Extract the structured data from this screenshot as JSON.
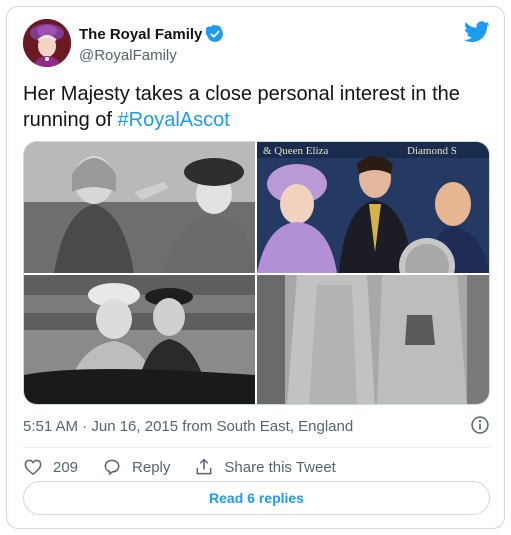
{
  "account": {
    "name": "The Royal Family",
    "handle": "@RoyalFamily"
  },
  "tweet": {
    "text": "Her Majesty takes a close personal interest in the running of ",
    "hashtag": "#RoyalAscot"
  },
  "media": {
    "sign_text": "& Queen Eliza",
    "sign_text_right": "Diamond S"
  },
  "meta": {
    "timestamp": "5:51 AM · Jun 16, 2015 from South East, England"
  },
  "actions": {
    "likes": "209",
    "reply_label": "Reply",
    "share_label": "Share this Tweet"
  },
  "replies_button": "Read 6 replies",
  "colors": {
    "brand": "#1d9bf0",
    "text": "#0f1419",
    "muted": "#536471",
    "border": "#cfd9de"
  },
  "icons": [
    "verified-badge-icon",
    "twitter-bird-icon",
    "info-icon",
    "heart-icon",
    "reply-icon",
    "share-icon"
  ]
}
